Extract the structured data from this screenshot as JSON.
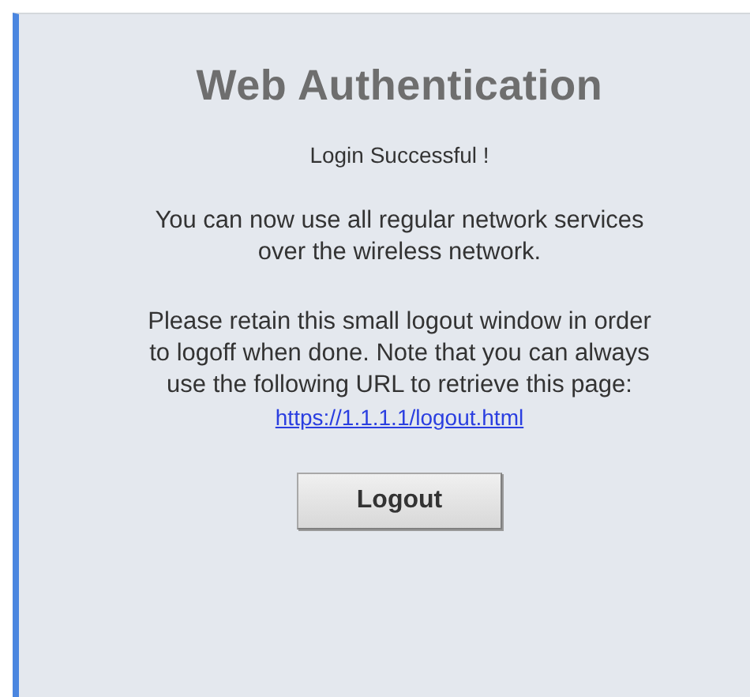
{
  "title": "Web Authentication",
  "status": "Login Successful !",
  "paragraphs": [
    {
      "lines": [
        "You can now use all regular network services",
        "over the wireless network."
      ]
    },
    {
      "lines": [
        "Please retain this small logout window in order",
        "to logoff when done. Note that you can always",
        "use the following URL to retrieve this page:"
      ]
    }
  ],
  "link": "https://1.1.1.1/logout.html",
  "button": "Logout"
}
